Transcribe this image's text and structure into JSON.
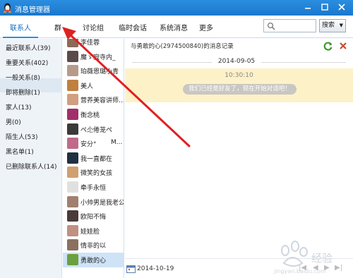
{
  "window": {
    "title": "消息管理器"
  },
  "tabs": [
    {
      "label": "联系人"
    },
    {
      "label": "群"
    },
    {
      "label": "讨论组"
    },
    {
      "label": "临时会话"
    },
    {
      "label": "系统消息"
    },
    {
      "label": "更多"
    }
  ],
  "search": {
    "placeholder": "",
    "button_label": "搜索"
  },
  "categories": [
    {
      "label": "最近联系人(39)"
    },
    {
      "label": "重要关系(402)"
    },
    {
      "label": "一般关系(8)"
    },
    {
      "label": "即将删除(1)"
    },
    {
      "label": "家人(13)"
    },
    {
      "label": "男(0)"
    },
    {
      "label": "陌生人(53)"
    },
    {
      "label": "黑名单(1)"
    },
    {
      "label": "已删除联系人(14)"
    }
  ],
  "contacts": [
    {
      "name": "李佳蓉",
      "avatar_color": "#8a6a58"
    },
    {
      "name": "魔ゞ寂寺内_",
      "avatar_color": "#5a4a4a"
    },
    {
      "name": "珀薇恩璐小青",
      "avatar_color": "#b89a8a"
    },
    {
      "name": "美人",
      "avatar_color": "#c08040"
    },
    {
      "name": "营养美容讲师...",
      "avatar_color": "#d0a080"
    },
    {
      "name": "衡念桃",
      "avatar_color": "#a0306a"
    },
    {
      "name": "ぺ尐倦茏ぺ",
      "avatar_color": "#3a3a3a"
    },
    {
      "name": "安分°",
      "avatar_color": "#c06a8a",
      "extra": "M..."
    },
    {
      "name": "我一直都在",
      "avatar_color": "#203040"
    },
    {
      "name": "微笑的女孩",
      "avatar_color": "#d0a070"
    },
    {
      "name": "牵手永恒",
      "avatar_color": "#e0e0e0"
    },
    {
      "name": "小帅男是我老公",
      "avatar_color": "#a08070"
    },
    {
      "name": "欧阳不悔",
      "avatar_color": "#4a3a3a"
    },
    {
      "name": "娃娃脸",
      "avatar_color": "#c09080"
    },
    {
      "name": "情非的以",
      "avatar_color": "#8a7060"
    },
    {
      "name": "勇敢的心",
      "avatar_color": "#6aa040"
    }
  ],
  "conversation": {
    "title": "与勇敢的心(2974500840)的消息记录",
    "date": "2014-09-05",
    "time": "10:30:10",
    "system_message": "我们已经是好友了，现在开始对话吧！",
    "footer_date": "2014-10-19"
  },
  "watermark": {
    "text_cn": "经验",
    "text_en": "jingyan.baidu.com"
  },
  "colors": {
    "titlebar": "#1a78cd",
    "annotation_arrow": "#e02020",
    "system_band": "#fdf1c8"
  }
}
